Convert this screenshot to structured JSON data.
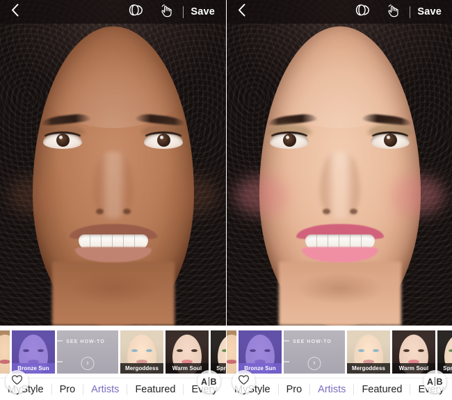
{
  "app": {
    "accent_purple": "#7a6bc0",
    "selected_overlay": "#7662cd"
  },
  "panels": [
    {
      "id": "before",
      "state_label": "before",
      "topbar": {
        "back_icon": "chevron-left-icon",
        "compare_icon": "overlapping-circles-icon",
        "touch_icon": "hand-touch-icon",
        "save_label": "Save"
      },
      "overlay": {
        "favorite_icon": "heart-outline-icon",
        "ab_a": "A",
        "ab_b": "B"
      }
    },
    {
      "id": "after",
      "state_label": "after",
      "topbar": {
        "back_icon": "chevron-left-icon",
        "compare_icon": "overlapping-circles-icon",
        "touch_icon": "hand-touch-icon",
        "save_label": "Save"
      },
      "overlay": {
        "favorite_icon": "heart-outline-icon",
        "ab_a": "A",
        "ab_b": "B"
      }
    }
  ],
  "strip": {
    "howto": {
      "text": "SEE HOW-TO",
      "arrow": "chevron-right-icon"
    },
    "looks": [
      {
        "name": "",
        "selected": false,
        "partial": true,
        "skin": "#e9c9a8",
        "hair": "#b08a63",
        "lip": "#c96d74",
        "eye": "#4a3322"
      },
      {
        "name": "Bronze Sun",
        "selected": true,
        "partial": false,
        "skin": "#bfa7e0",
        "hair": "#4b3c7a",
        "lip": "#8e6ec0",
        "eye": "#2e2347"
      },
      {
        "name": "Mergoddess",
        "selected": false,
        "partial": false,
        "skin": "#f0d6bd",
        "hair": "#e2d3bd",
        "lip": "#d89a96",
        "eye": "#8fb6c9"
      },
      {
        "name": "Warm Soul",
        "selected": false,
        "partial": false,
        "skin": "#e9cdba",
        "hair": "#3b2e2a",
        "lip": "#e0868c",
        "eye": "#4e3a2c"
      },
      {
        "name": "SpringFling",
        "selected": false,
        "partial": false,
        "skin": "#edd5c0",
        "hair": "#2a2724",
        "lip": "#f07fb6",
        "eye": "#6e8f52"
      },
      {
        "name": "",
        "selected": false,
        "partial": true,
        "skin": "#e8c7a6",
        "hair": "#c0a07a",
        "lip": "#cf7a84",
        "eye": "#4a3322"
      }
    ]
  },
  "tabs": {
    "items": [
      {
        "label": "MyStyle",
        "active": false
      },
      {
        "label": "Pro",
        "active": false
      },
      {
        "label": "Artists",
        "active": true
      },
      {
        "label": "Featured",
        "active": false
      },
      {
        "label": "Every",
        "active": false
      }
    ]
  }
}
